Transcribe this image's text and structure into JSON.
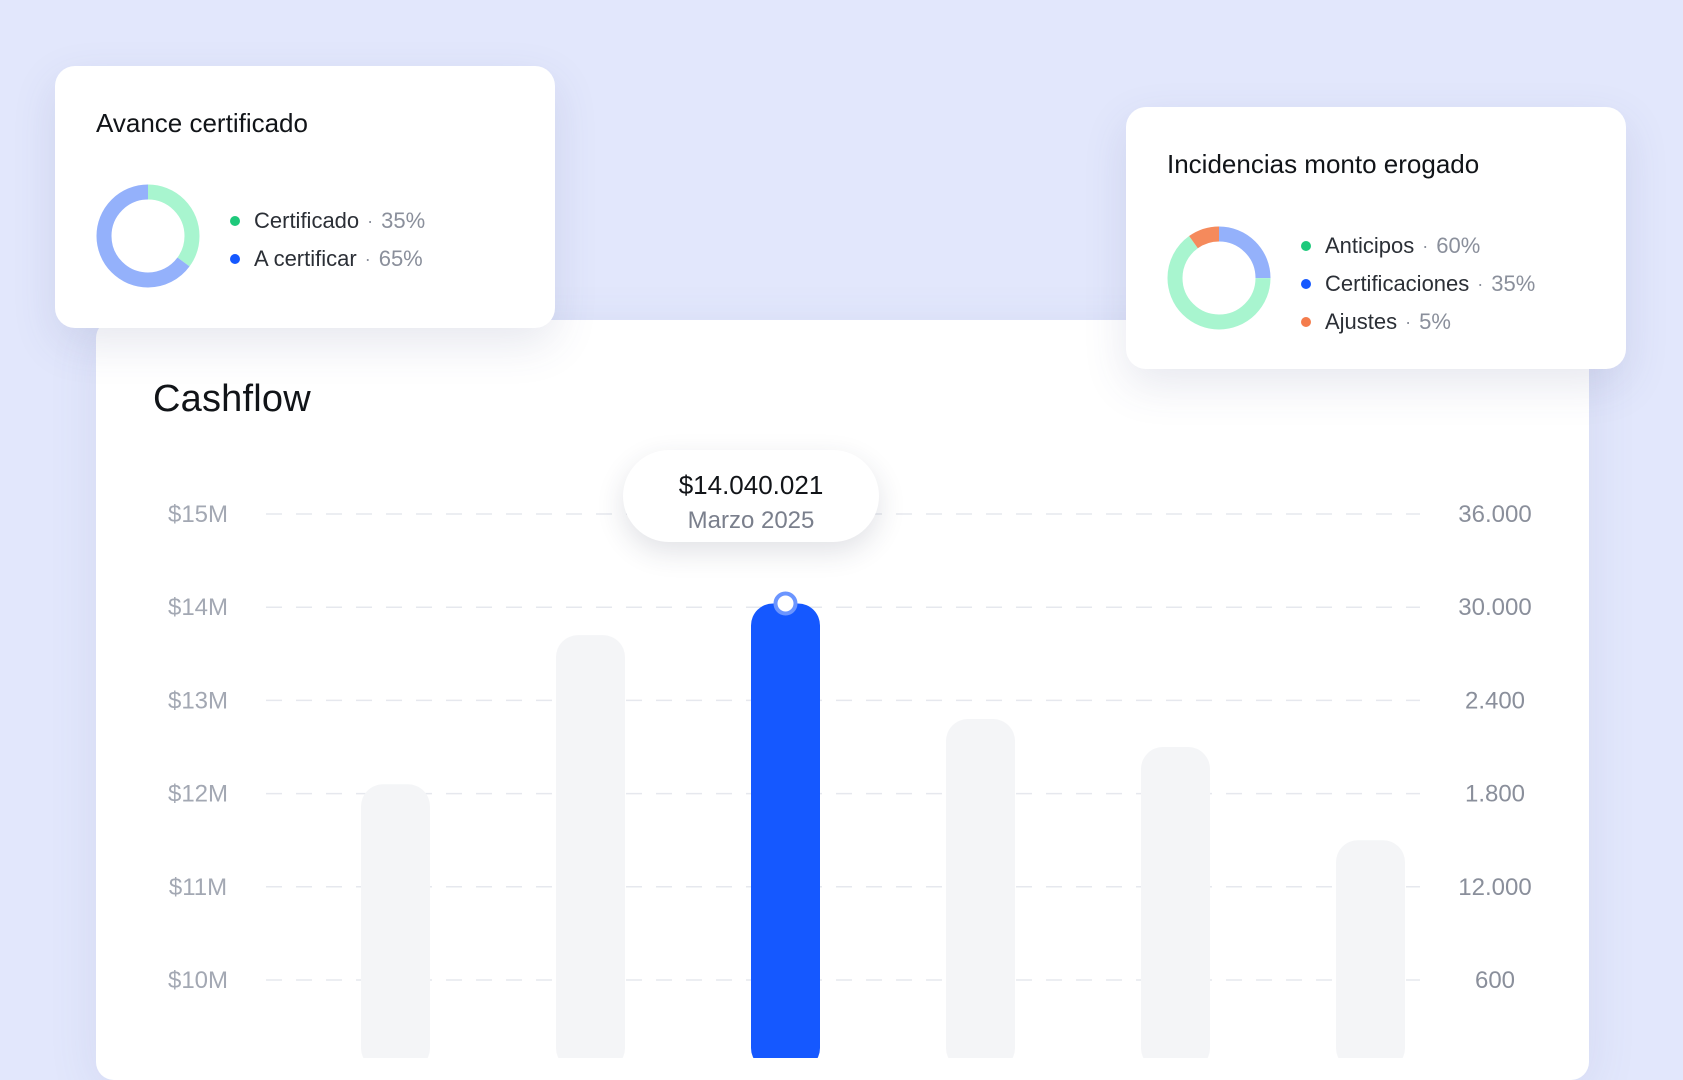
{
  "colors": {
    "accent": "#1558ff",
    "bar_muted": "#f4f5f7",
    "green": "#1ec97b",
    "blue": "#1558ff",
    "orange": "#f47c4c",
    "donut_green": "#a8f5cf",
    "donut_blue": "#94b1fb",
    "donut_orange": "#f58a5c"
  },
  "cards": {
    "avance": {
      "title": "Avance certificado",
      "items": [
        {
          "name": "Certificado",
          "pct": "35%",
          "value": 35,
          "dot": "green"
        },
        {
          "name": "A certificar",
          "pct": "65%",
          "value": 65,
          "dot": "blue"
        }
      ]
    },
    "incidencias": {
      "title": "Incidencias monto erogado",
      "items": [
        {
          "name": "Anticipos",
          "pct": "60%",
          "value": 60,
          "dot": "green"
        },
        {
          "name": "Certificaciones",
          "pct": "35%",
          "value": 35,
          "dot": "blue"
        },
        {
          "name": "Ajustes",
          "pct": "5%",
          "value": 5,
          "dot": "orange"
        }
      ]
    },
    "separator": "·"
  },
  "cashflow": {
    "title": "Cashflow",
    "tooltip": {
      "value": "$14.040.021",
      "label": "Marzo 2025"
    }
  },
  "chart_data": {
    "type": "bar",
    "title": "Cashflow",
    "y_ticks_left": [
      "$15M",
      "$14M",
      "$13M",
      "$12M",
      "$11M",
      "$10M"
    ],
    "y_ticks_right": [
      "36.000",
      "30.000",
      "2.400",
      "1.800",
      "12.000",
      "600"
    ],
    "ylim": [
      9,
      15
    ],
    "grid": true,
    "values": [
      12.1,
      13.7,
      14.04,
      12.8,
      12.5,
      11.5
    ],
    "highlighted_index": 2
  }
}
